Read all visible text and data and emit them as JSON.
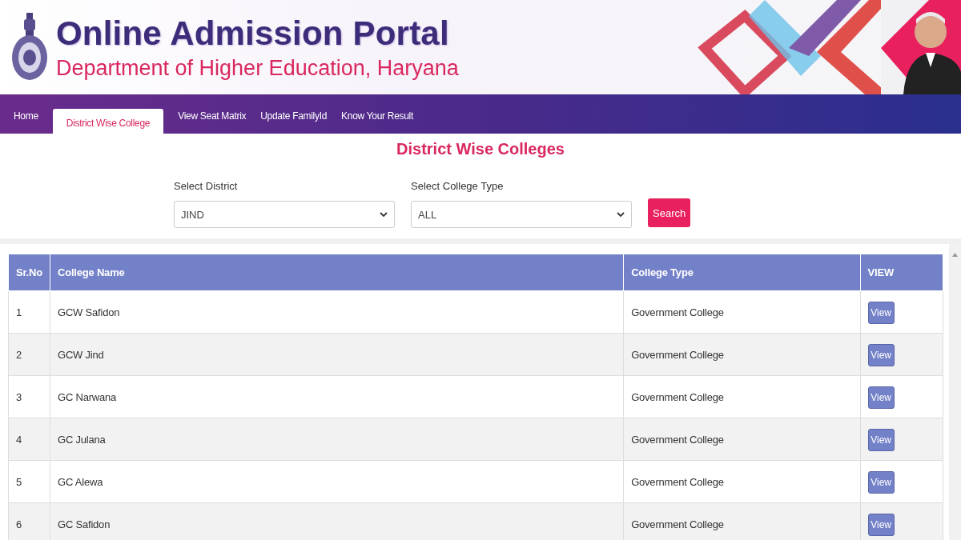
{
  "header": {
    "title": "Online Admission Portal",
    "subtitle": "Department of Higher Education, Haryana"
  },
  "nav": {
    "items": [
      {
        "label": "Home",
        "selected": false
      },
      {
        "label": "District Wise College",
        "selected": true
      },
      {
        "label": "View Seat Matrix",
        "selected": false
      },
      {
        "label": "Update FamilyId",
        "selected": false
      },
      {
        "label": "Know Your Result",
        "selected": false
      }
    ]
  },
  "page_title": "District Wise Colleges",
  "filters": {
    "fields": [
      {
        "label": "Select District",
        "value": "JIND"
      },
      {
        "label": "Select College Type",
        "value": "ALL"
      }
    ],
    "search_button": "Search"
  },
  "table": {
    "columns": [
      "Sr.No",
      "College Name",
      "College Type",
      "VIEW"
    ],
    "rows": [
      {
        "sr_no": "1",
        "college_name": "GCW Safidon",
        "college_type": "Government College",
        "action": "View"
      },
      {
        "sr_no": "2",
        "college_name": "GCW Jind",
        "college_type": "Government College",
        "action": "View"
      },
      {
        "sr_no": "3",
        "college_name": "GC Narwana",
        "college_type": "Government College",
        "action": "View"
      },
      {
        "sr_no": "4",
        "college_name": "GC Julana",
        "college_type": "Government College",
        "action": "View"
      },
      {
        "sr_no": "5",
        "college_name": "GC Alewa",
        "college_type": "Government College",
        "action": "View"
      },
      {
        "sr_no": "6",
        "college_name": "GC Safidon",
        "college_type": "Government College",
        "action": "View"
      }
    ]
  }
}
